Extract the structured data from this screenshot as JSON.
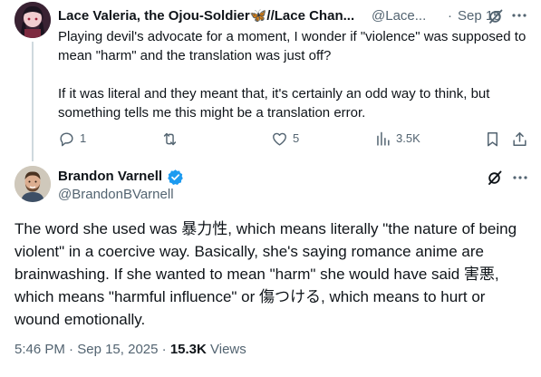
{
  "reply_tweet": {
    "display_name": "Lace Valeria, the Ojou-Soldier🦋//Lace Chan...",
    "handle": "@Lace...",
    "separator": "·",
    "date": "Sep 15",
    "paragraphs": [
      "Playing devil's advocate for a moment, I wonder if \"violence\" was supposed to mean \"harm\" and the translation was just off?",
      "If it was literal and they meant that, it's certainly an odd way to think, but something tells me this might be a translation error."
    ],
    "actions": {
      "reply_count": "1",
      "repost_count": "",
      "like_count": "5",
      "view_count": "3.5K"
    },
    "icons": [
      "avatar",
      "grok-icon",
      "more-icon",
      "reply-icon",
      "repost-icon",
      "like-icon",
      "views-icon",
      "bookmark-icon",
      "share-icon"
    ]
  },
  "main_tweet": {
    "display_name": "Brandon Varnell",
    "handle": "@BrandonBVarnell",
    "verified": true,
    "body": "The word she used was 暴力性, which means literally \"the nature of being violent\" in a coercive way. Basically, she's saying romance anime are brainwashing. If she wanted to mean \"harm\" she would have said 害悪, which means \"harmful influence\" or 傷つける, which means to hurt or wound emotionally.",
    "time": "5:46 PM",
    "separator": "·",
    "date": "Sep 15, 2025",
    "views_count": "15.3K",
    "views_label": "Views"
  },
  "colors": {
    "text_primary": "#0f1419",
    "text_secondary": "#536471",
    "verified_blue": "#1d9bf0",
    "thread_line": "#cfd9de"
  }
}
